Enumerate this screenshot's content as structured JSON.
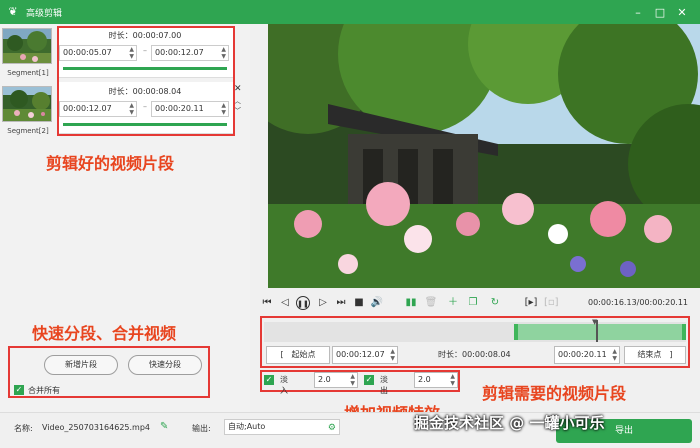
{
  "window": {
    "title": "高级剪辑",
    "controls": {
      "minimize": "–",
      "maximize": "□",
      "close": "✕"
    }
  },
  "segments": [
    {
      "label": "Segment[1]",
      "duration": "时长：00:00:07.00",
      "start": "00:00:05.07",
      "end": "00:00:12.07"
    },
    {
      "label": "Segment[2]",
      "duration": "时长：00:00:08.04",
      "start": "00:00:12.07",
      "end": "00:00:20.11"
    }
  ],
  "annotations": {
    "clipped_segments": "剪辑好的视频片段",
    "quick_split_merge": "快速分段、合并视频",
    "needed_segments": "剪辑需要的视频片段",
    "add_effects": "增加视频特效"
  },
  "left_actions": {
    "add_segment": "新增片段",
    "quick_split": "快速分段",
    "merge_all": "合并所有"
  },
  "player": {
    "timecode": "00:00:16.13/00:00:20.11"
  },
  "trim": {
    "start_button": "[　起始点",
    "start_value": "00:00:12.07",
    "duration": "时长：00:00:08.04",
    "end_value": "00:00:20.11",
    "end_button": "结束点　]"
  },
  "effects": {
    "fade_in_label": "淡入",
    "fade_in_value": "2.0",
    "fade_out_label": "淡出",
    "fade_out_value": "2.0"
  },
  "footer": {
    "name_label": "名称:",
    "name_value": "Video_250703164625.mp4",
    "output_label": "输出:",
    "output_value": "自动;Auto",
    "export_label": "导出"
  },
  "watermark": "掘金技术社区 @ 一罐小可乐",
  "colors": {
    "accent": "#2fa551",
    "annotation": "#e8451f",
    "box": "#e53935"
  }
}
